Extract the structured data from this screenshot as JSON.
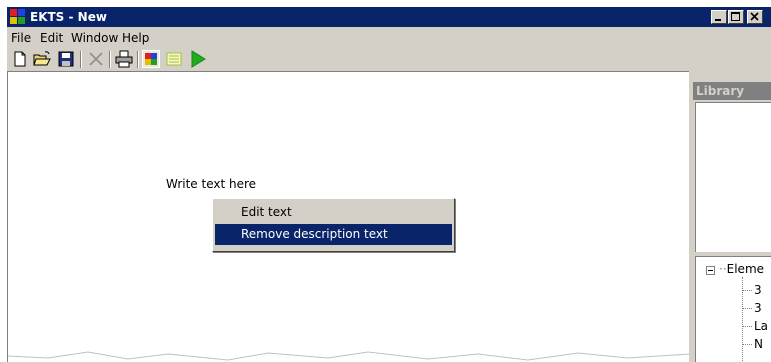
{
  "window": {
    "title": "EKTS - New"
  },
  "menu": {
    "items": [
      "File",
      "Edit",
      "Window",
      "Help"
    ]
  },
  "toolbar": {
    "buttons": [
      "new-document-icon",
      "open-folder-icon",
      "save-disk-icon",
      "delete-x-icon",
      "print-icon",
      "color-palette-icon",
      "grid-icon",
      "run-play-icon"
    ]
  },
  "canvas": {
    "text": "Write text here"
  },
  "context_menu": {
    "items": [
      "Edit text",
      "Remove description text"
    ],
    "selected_index": 1
  },
  "library": {
    "title": "Library",
    "tree": {
      "root": "Eleme",
      "children": [
        "3",
        "3",
        "La",
        "N"
      ]
    }
  },
  "colors": {
    "titlebar": "#0a246a",
    "selection": "#0a246a",
    "chrome": "#d4d0c8",
    "play": "#22aa22"
  }
}
